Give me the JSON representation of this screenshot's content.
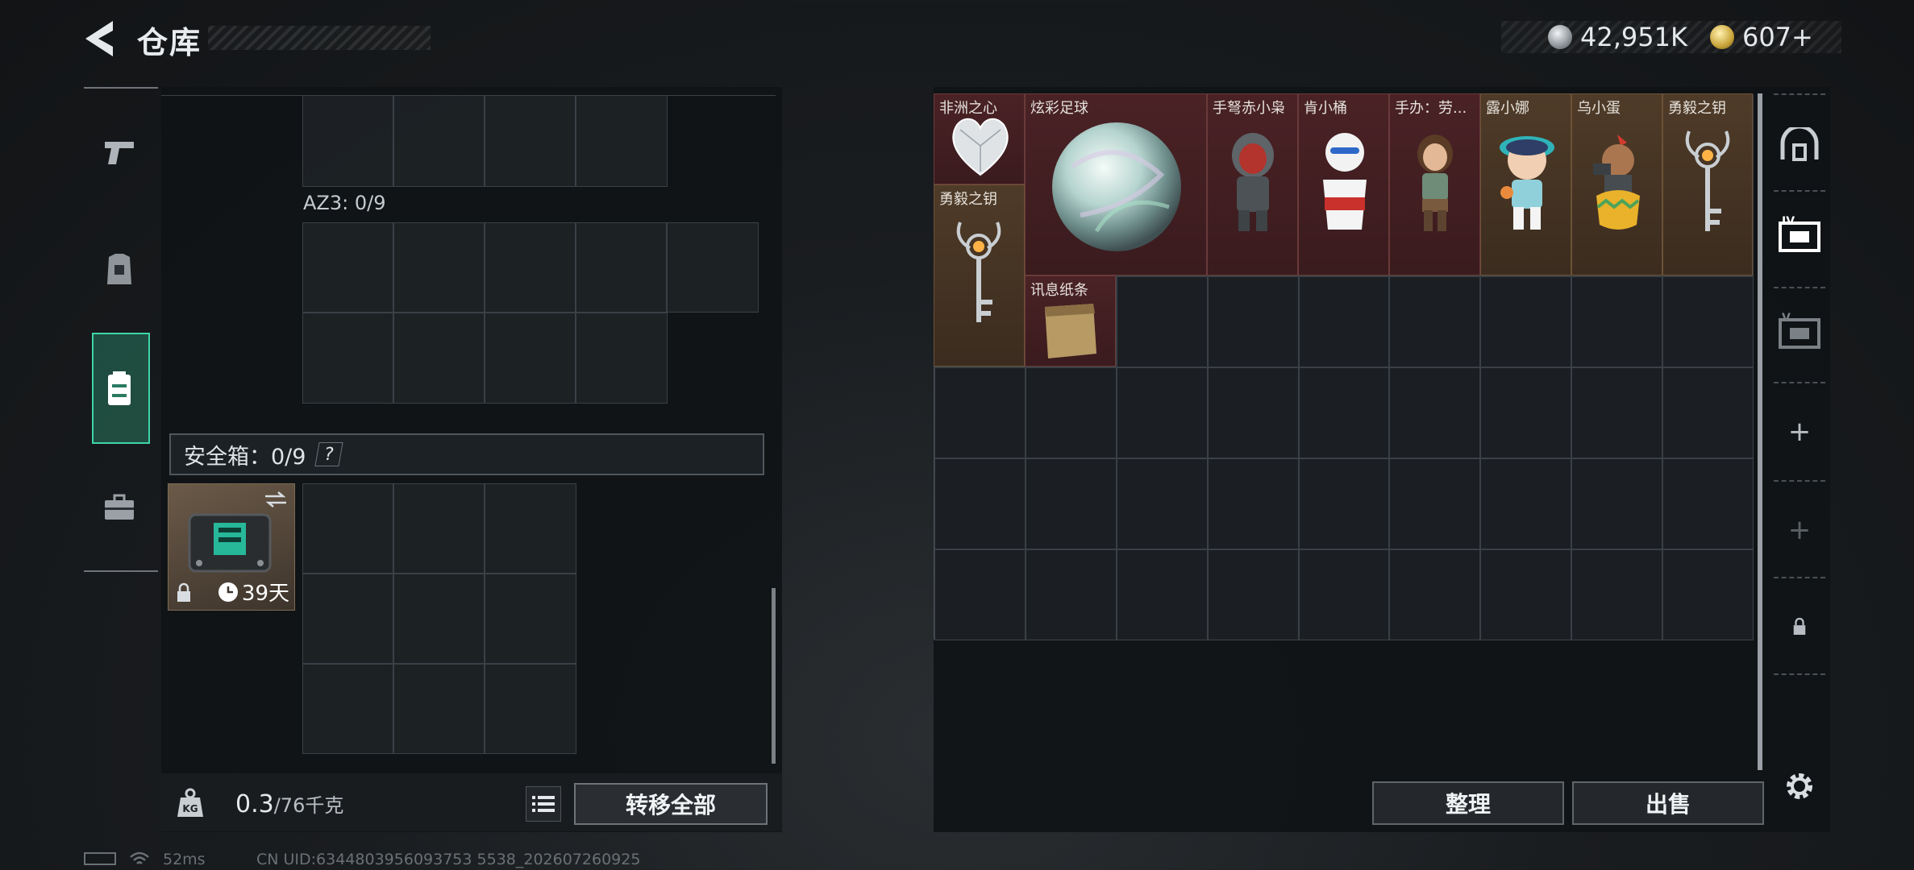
{
  "header": {
    "title": "仓库",
    "currency": [
      {
        "icon": "silver-coin-icon",
        "value": "42,951K"
      },
      {
        "icon": "gold-coin-icon",
        "value": "607+"
      }
    ]
  },
  "left_rail": {
    "items": [
      {
        "icon": "pistol-icon"
      },
      {
        "icon": "armor-vest-icon"
      },
      {
        "icon": "backpack-icon",
        "active": true
      },
      {
        "icon": "toolbox-icon"
      }
    ]
  },
  "left_panel": {
    "az3_label": "AZ3: 0/9",
    "safebox_label": "安全箱：0/9",
    "safebox_help": "?",
    "safe_item": {
      "days": "39天"
    },
    "weight": {
      "current": "0.3",
      "capacity": "/76千克"
    },
    "transfer_all": "转移全部"
  },
  "stash": {
    "items": [
      {
        "name": "非洲之心"
      },
      {
        "name": "炫彩足球"
      },
      {
        "name": "手弩赤小枭"
      },
      {
        "name": "肯小桶"
      },
      {
        "name": "手办：劳..."
      },
      {
        "name": "露小娜"
      },
      {
        "name": "乌小蛋"
      },
      {
        "name": "勇毅之钥"
      },
      {
        "name": "勇毅之钥"
      },
      {
        "name": "讯息纸条"
      }
    ],
    "sort_label": "整理",
    "sell_label": "出售"
  },
  "right_rail": {
    "items": [
      {
        "icon": "vault-icon"
      },
      {
        "icon": "stash-tab-iv-icon"
      },
      {
        "icon": "stash-tab-v-icon"
      },
      {
        "label": "+"
      },
      {
        "label": "+"
      },
      {
        "icon": "lock-icon"
      },
      {
        "icon": "gear-icon"
      }
    ]
  },
  "status_bar": {
    "ping": "52ms",
    "uid": "CN UID:6344803956093753 5538_202607260925"
  }
}
